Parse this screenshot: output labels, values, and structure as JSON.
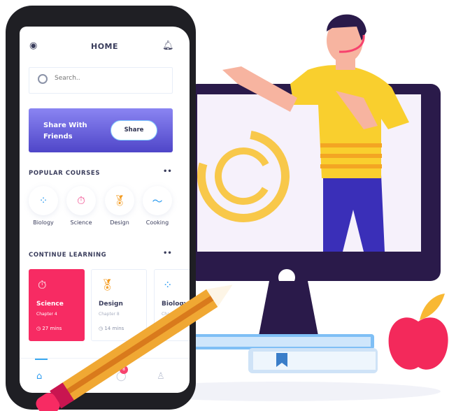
{
  "header": {
    "title": "HOME",
    "left_icon": "settings-icon",
    "right_icon": "bell-icon"
  },
  "search": {
    "placeholder": "Search.."
  },
  "banner": {
    "text": "Share With Friends",
    "button_label": "Share"
  },
  "popular": {
    "title": "POPULAR COURSES",
    "more": "••",
    "items": [
      {
        "label": "Biology",
        "icon": "grid-icon",
        "color": "#2d9cf0"
      },
      {
        "label": "Science",
        "icon": "stopwatch-icon",
        "color": "#f0468a"
      },
      {
        "label": "Design",
        "icon": "award-icon",
        "color": "#f39a1e"
      },
      {
        "label": "Cooking",
        "icon": "pulse-icon",
        "color": "#2d9cf0"
      }
    ]
  },
  "continue": {
    "title": "CONTINUE LEARNING",
    "more": "••",
    "cards": [
      {
        "name": "Science",
        "chapter": "Chapter 4",
        "time": "27 mins",
        "active": true
      },
      {
        "name": "Design",
        "chapter": "Chapter 8",
        "time": "14 mins"
      },
      {
        "name": "Biology",
        "chapter": "Chapter"
      }
    ]
  },
  "nav": {
    "items": [
      "home-icon",
      "pencil-icon",
      "chat-icon",
      "user-icon"
    ],
    "badge": "8"
  },
  "colors": {
    "accent": "#f72b63",
    "banner": "#5b52d6",
    "monitor": "#2a1a4a",
    "donut": "#f8c84a"
  }
}
